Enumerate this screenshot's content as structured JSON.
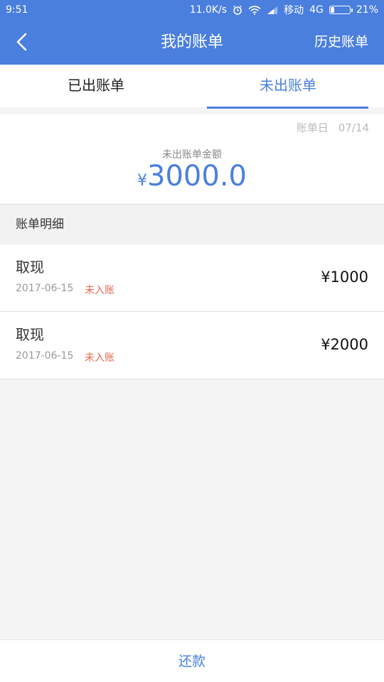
{
  "status_bar": {
    "time": "9:51",
    "net_speed": "11.0K/s",
    "carrier": "移动",
    "network": "4G",
    "battery": "21%",
    "battery_level": 0.21,
    "icons": [
      "alarm-icon",
      "wifi-icon",
      "signal-icon",
      "battery-icon"
    ]
  },
  "navbar": {
    "title": "我的账单",
    "history_label": "历史账单",
    "back_icon": "chevron-left-icon"
  },
  "tabs": [
    {
      "label": "已出账单",
      "active": false
    },
    {
      "label": "未出账单",
      "active": true
    }
  ],
  "summary": {
    "bill_day_label": "账单日",
    "bill_day": "07/14",
    "amount_label": "未出账单金额",
    "currency": "¥",
    "amount": "3000.0"
  },
  "details": {
    "header": "账单明细",
    "items": [
      {
        "title": "取现",
        "date": "2017-06-15",
        "status": "未入账",
        "amount": "¥1000"
      },
      {
        "title": "取现",
        "date": "2017-06-15",
        "status": "未入账",
        "amount": "¥2000"
      }
    ]
  },
  "footer": {
    "repay_label": "还款"
  },
  "colors": {
    "primary": "#4a7fde",
    "status_pending": "#e56a4f",
    "background": "#f4f4f4"
  }
}
